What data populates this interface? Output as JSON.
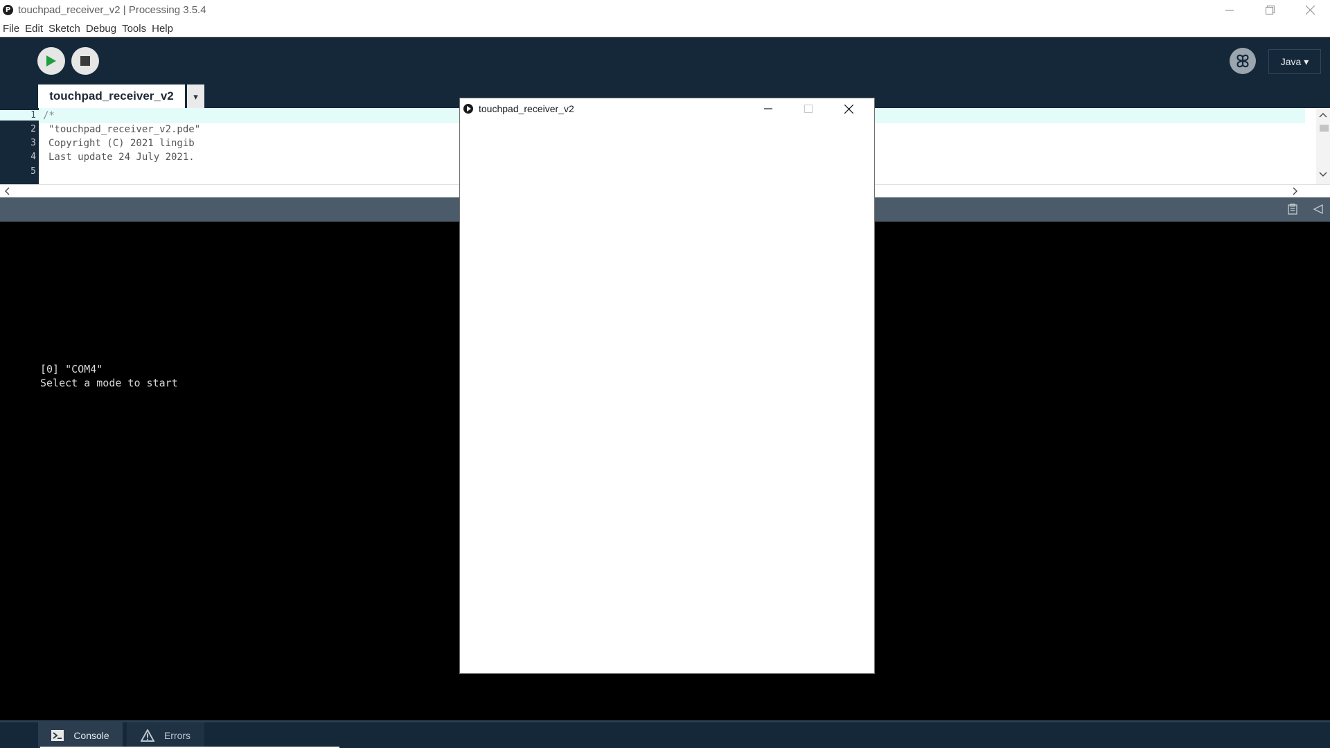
{
  "window": {
    "title": "touchpad_receiver_v2 | Processing 3.5.4",
    "app_icon_letter": "P"
  },
  "menu": [
    "File",
    "Edit",
    "Sketch",
    "Debug",
    "Tools",
    "Help"
  ],
  "toolbar": {
    "run_icon": "play-icon",
    "stop_icon": "stop-icon",
    "debug_icon": "butterfly-icon",
    "mode_label": "Java ▾"
  },
  "editor": {
    "tab_label": "touchpad_receiver_v2",
    "tab_menu_glyph": "▾",
    "line_numbers": [
      "1",
      "2",
      "3",
      "4",
      "5"
    ],
    "lines": [
      "/*",
      "\"touchpad_receiver_v2.pde\"",
      "Copyright (C) 2021 lingib",
      "Last update 24 July 2021.",
      ""
    ]
  },
  "console": {
    "lines": [
      "[0] \"COM4\"",
      "Select a mode to start"
    ]
  },
  "footer": {
    "console_label": "Console",
    "errors_label": "Errors"
  },
  "sketch_window": {
    "title": "touchpad_receiver_v2"
  },
  "colors": {
    "toolbar_bg": "#15283a",
    "run_green": "#1f9e3b",
    "line_highlight": "#e3fcfa"
  }
}
